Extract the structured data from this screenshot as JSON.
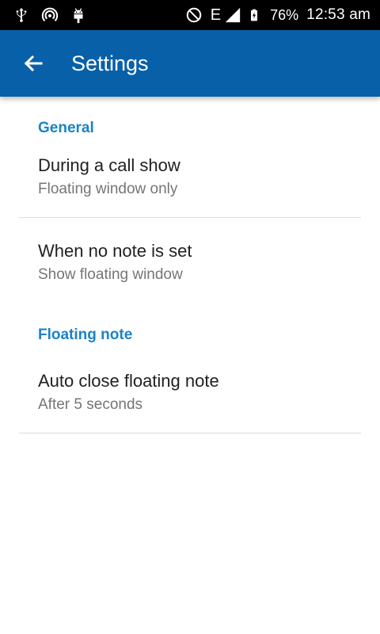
{
  "status_bar": {
    "icons_left": [
      "usb-icon",
      "hotspot-icon",
      "android-debug-icon"
    ],
    "network": "E",
    "battery_percent": "76%",
    "time": "12:53 am"
  },
  "app_bar": {
    "title": "Settings",
    "color": "#0860a8"
  },
  "sections": [
    {
      "header": "General",
      "items": [
        {
          "title": "During a call show",
          "summary": "Floating window only"
        },
        {
          "title": "When no note is set",
          "summary": "Show floating window"
        }
      ]
    },
    {
      "header": "Floating note",
      "items": [
        {
          "title": "Auto close floating note",
          "summary": "After 5 seconds"
        }
      ]
    }
  ],
  "colors": {
    "accent": "#1a83c8",
    "title_text": "#212121",
    "summary_text": "#757575"
  }
}
